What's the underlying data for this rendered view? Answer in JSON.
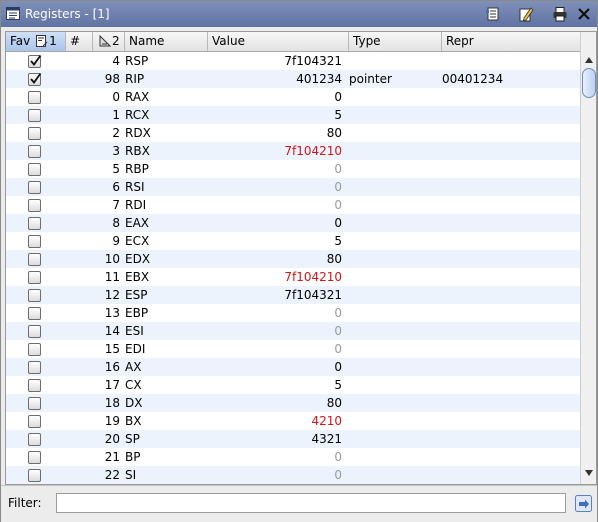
{
  "window": {
    "title": "Registers - [1]"
  },
  "toolbar": {
    "icons": [
      "columns-icon",
      "edit-pen-icon",
      "print-icon",
      "close-icon"
    ]
  },
  "table": {
    "headers": {
      "fav": "Fav",
      "fav_sort_index": "1",
      "num": "#",
      "num_sort_index": "2",
      "name": "Name",
      "value": "Value",
      "type": "Type",
      "repr": "Repr"
    },
    "rows": [
      {
        "fav": true,
        "num": "4",
        "name": "RSP",
        "value": "7f104321",
        "value_style": "normal",
        "type": "",
        "repr": ""
      },
      {
        "fav": true,
        "num": "98",
        "name": "RIP",
        "value": "401234",
        "value_style": "normal",
        "type": "pointer",
        "repr": "00401234"
      },
      {
        "fav": false,
        "num": "0",
        "name": "RAX",
        "value": "0",
        "value_style": "normal",
        "type": "",
        "repr": ""
      },
      {
        "fav": false,
        "num": "1",
        "name": "RCX",
        "value": "5",
        "value_style": "normal",
        "type": "",
        "repr": ""
      },
      {
        "fav": false,
        "num": "2",
        "name": "RDX",
        "value": "80",
        "value_style": "normal",
        "type": "",
        "repr": ""
      },
      {
        "fav": false,
        "num": "3",
        "name": "RBX",
        "value": "7f104210",
        "value_style": "changed",
        "type": "",
        "repr": ""
      },
      {
        "fav": false,
        "num": "5",
        "name": "RBP",
        "value": "0",
        "value_style": "unknown",
        "type": "",
        "repr": ""
      },
      {
        "fav": false,
        "num": "6",
        "name": "RSI",
        "value": "0",
        "value_style": "unknown",
        "type": "",
        "repr": ""
      },
      {
        "fav": false,
        "num": "7",
        "name": "RDI",
        "value": "0",
        "value_style": "unknown",
        "type": "",
        "repr": ""
      },
      {
        "fav": false,
        "num": "8",
        "name": "EAX",
        "value": "0",
        "value_style": "normal",
        "type": "",
        "repr": ""
      },
      {
        "fav": false,
        "num": "9",
        "name": "ECX",
        "value": "5",
        "value_style": "normal",
        "type": "",
        "repr": ""
      },
      {
        "fav": false,
        "num": "10",
        "name": "EDX",
        "value": "80",
        "value_style": "normal",
        "type": "",
        "repr": ""
      },
      {
        "fav": false,
        "num": "11",
        "name": "EBX",
        "value": "7f104210",
        "value_style": "changed",
        "type": "",
        "repr": ""
      },
      {
        "fav": false,
        "num": "12",
        "name": "ESP",
        "value": "7f104321",
        "value_style": "normal",
        "type": "",
        "repr": ""
      },
      {
        "fav": false,
        "num": "13",
        "name": "EBP",
        "value": "0",
        "value_style": "unknown",
        "type": "",
        "repr": ""
      },
      {
        "fav": false,
        "num": "14",
        "name": "ESI",
        "value": "0",
        "value_style": "unknown",
        "type": "",
        "repr": ""
      },
      {
        "fav": false,
        "num": "15",
        "name": "EDI",
        "value": "0",
        "value_style": "unknown",
        "type": "",
        "repr": ""
      },
      {
        "fav": false,
        "num": "16",
        "name": "AX",
        "value": "0",
        "value_style": "normal",
        "type": "",
        "repr": ""
      },
      {
        "fav": false,
        "num": "17",
        "name": "CX",
        "value": "5",
        "value_style": "normal",
        "type": "",
        "repr": ""
      },
      {
        "fav": false,
        "num": "18",
        "name": "DX",
        "value": "80",
        "value_style": "normal",
        "type": "",
        "repr": ""
      },
      {
        "fav": false,
        "num": "19",
        "name": "BX",
        "value": "4210",
        "value_style": "changed",
        "type": "",
        "repr": ""
      },
      {
        "fav": false,
        "num": "20",
        "name": "SP",
        "value": "4321",
        "value_style": "normal",
        "type": "",
        "repr": ""
      },
      {
        "fav": false,
        "num": "21",
        "name": "BP",
        "value": "0",
        "value_style": "unknown",
        "type": "",
        "repr": ""
      },
      {
        "fav": false,
        "num": "22",
        "name": "SI",
        "value": "0",
        "value_style": "unknown",
        "type": "",
        "repr": ""
      }
    ]
  },
  "filter": {
    "label": "Filter:",
    "value": ""
  },
  "colors": {
    "title_bar": "#6a7dac",
    "changed_value": "#d21414",
    "unknown_value": "#9a9a9a",
    "alt_row": "#edf3fc",
    "sorted_header": "#bcd2f0"
  }
}
